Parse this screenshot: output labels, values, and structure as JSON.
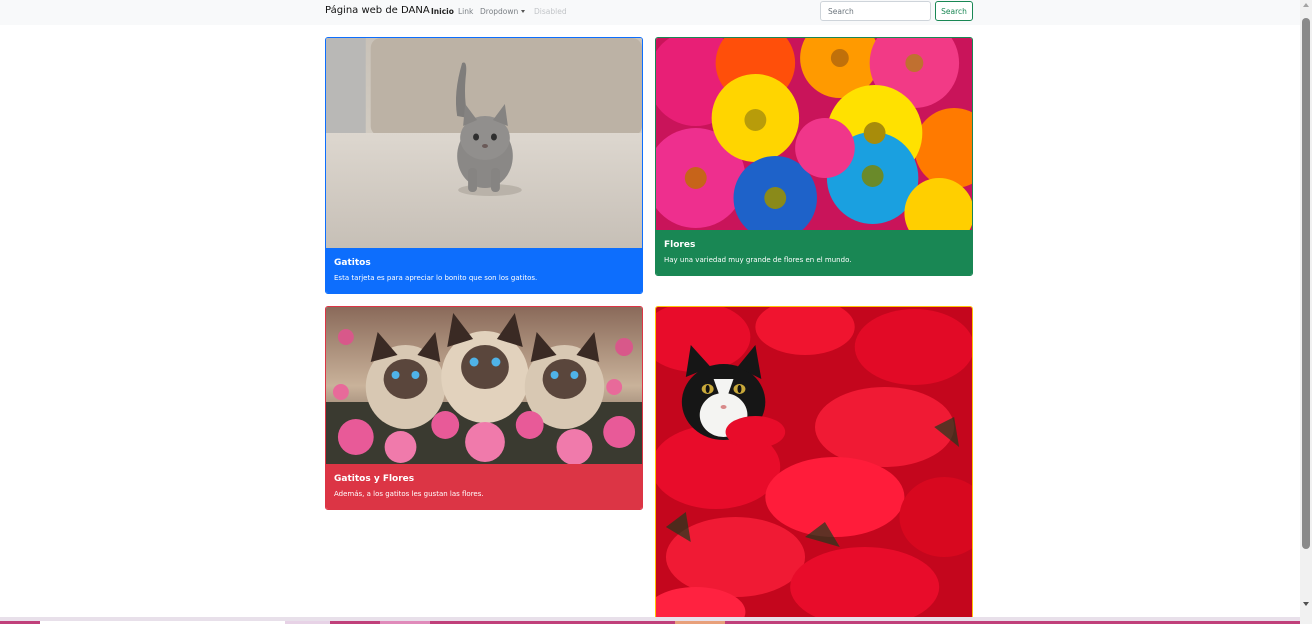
{
  "navbar": {
    "brand": "Página web de DANA",
    "links": [
      {
        "label": "Inicio",
        "state": "active"
      },
      {
        "label": "Link",
        "state": "normal"
      },
      {
        "label": "Dropdown",
        "state": "dropdown"
      },
      {
        "label": "Disabled",
        "state": "disabled"
      }
    ],
    "search_placeholder": "Search",
    "search_button": "Search"
  },
  "cards": [
    {
      "title": "Gatitos",
      "text": "Esta tarjeta es para apreciar lo bonito que son los gatitos.",
      "color": "#0d6efd",
      "image": "kitten-photo"
    },
    {
      "title": "Flores",
      "text": "Hay una variedad muy grande de flores en el mundo.",
      "color": "#198754",
      "image": "daisies-photo"
    },
    {
      "title": "Gatitos y Flores",
      "text": "Además, a los gatitos les gustan las flores.",
      "color": "#dc3545",
      "image": "siamese-cats-flowers-photo"
    },
    {
      "image": "cat-in-poinsettias-photo",
      "color": "#ffc107"
    }
  ]
}
